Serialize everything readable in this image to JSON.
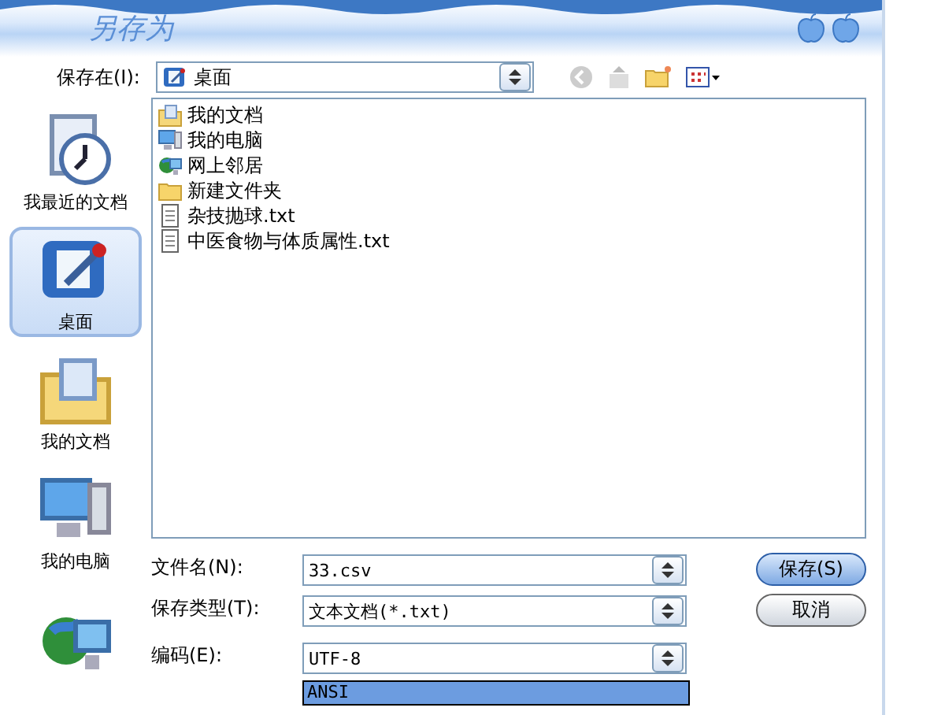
{
  "window": {
    "title": "另存为"
  },
  "look_in": {
    "label": "保存在(I):",
    "value": "桌面"
  },
  "places": [
    {
      "kind": "recent",
      "label": "我最近的文档",
      "selected": false
    },
    {
      "kind": "desktop",
      "label": "桌面",
      "selected": true
    },
    {
      "kind": "documents",
      "label": "我的文档",
      "selected": false
    },
    {
      "kind": "computer",
      "label": "我的电脑",
      "selected": false
    },
    {
      "kind": "network",
      "selected": false
    }
  ],
  "files": [
    {
      "kind": "documents",
      "name": "我的文档"
    },
    {
      "kind": "computer",
      "name": "我的电脑"
    },
    {
      "kind": "network",
      "name": "网上邻居"
    },
    {
      "kind": "folder",
      "name": "新建文件夹"
    },
    {
      "kind": "text",
      "name": "杂技抛球.txt"
    },
    {
      "kind": "text",
      "name": "中医食物与体质属性.txt"
    }
  ],
  "fields": [
    {
      "label": "文件名(N):",
      "value": "33.csv"
    },
    {
      "label": "保存类型(T):",
      "value": "文本文档(*.txt)"
    },
    {
      "label": "编码(E):",
      "value": "UTF-8"
    }
  ],
  "encoding_options": [
    {
      "label": "ANSI",
      "selected": true
    }
  ],
  "buttons": [
    {
      "label": "保存(S)",
      "default": true
    },
    {
      "label": "取消",
      "default": false
    }
  ]
}
